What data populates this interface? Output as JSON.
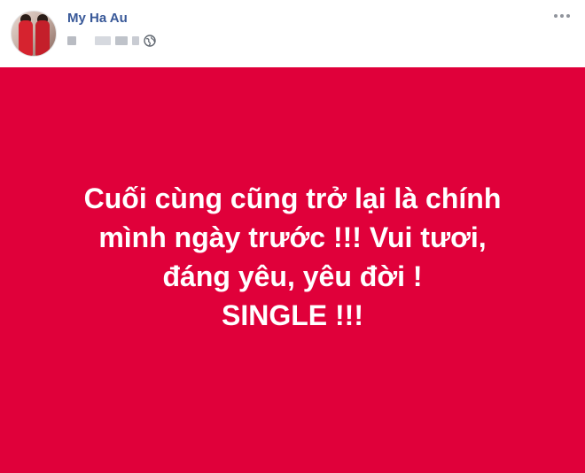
{
  "post": {
    "author_name": "My Ha Au",
    "privacy": "public",
    "status_lines": [
      "Cuối cùng cũng trở lại là chính",
      "mình ngày trước !!! Vui tươi,",
      "đáng yêu, yêu đời !",
      "SINGLE !!!"
    ]
  },
  "colors": {
    "status_background": "#e0003a",
    "status_text": "#ffffff",
    "author_name": "#385898"
  },
  "icons": {
    "privacy": "globe-icon",
    "menu": "more-options-icon"
  }
}
